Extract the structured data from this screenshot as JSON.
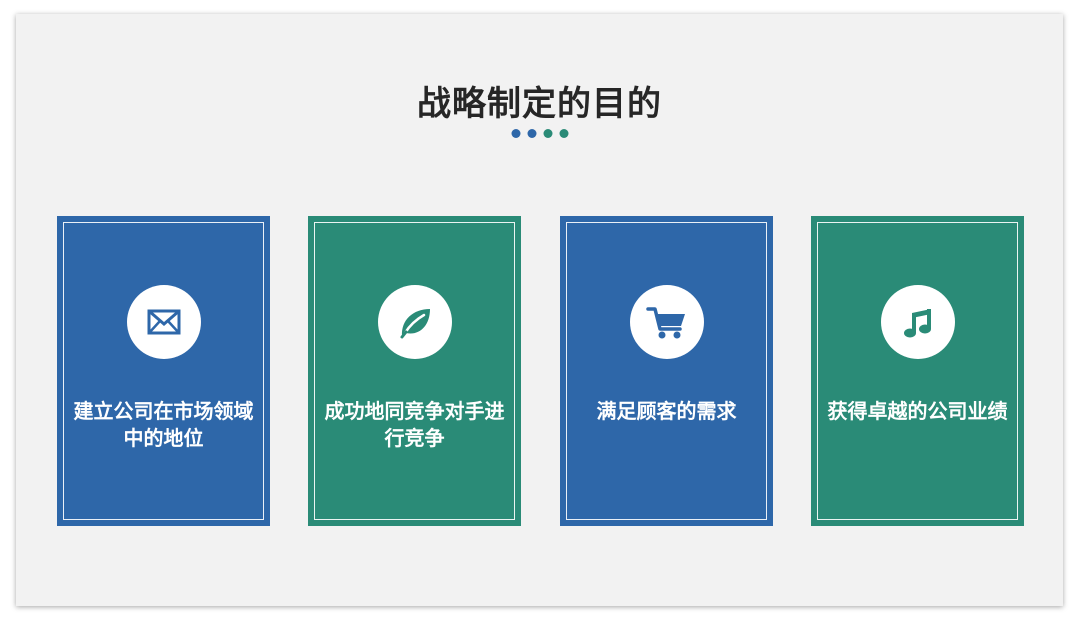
{
  "title": "战略制定的目的",
  "colors": {
    "blue": "#2e67a9",
    "green": "#2a8b77",
    "background": "#f2f2f2"
  },
  "dots": [
    "#2e67a9",
    "#2e67a9",
    "#2a8b77",
    "#2a8b77"
  ],
  "cards": [
    {
      "icon": "envelope-icon",
      "text": "建立公司在市场领域中的地位",
      "color": "#2e67a9"
    },
    {
      "icon": "leaf-icon",
      "text": "成功地同竞争对手进行竞争",
      "color": "#2a8b77"
    },
    {
      "icon": "shopping-cart-icon",
      "text": "满足顾客的需求",
      "color": "#2e67a9"
    },
    {
      "icon": "music-note-icon",
      "text": "获得卓越的公司业绩",
      "color": "#2a8b77"
    }
  ]
}
